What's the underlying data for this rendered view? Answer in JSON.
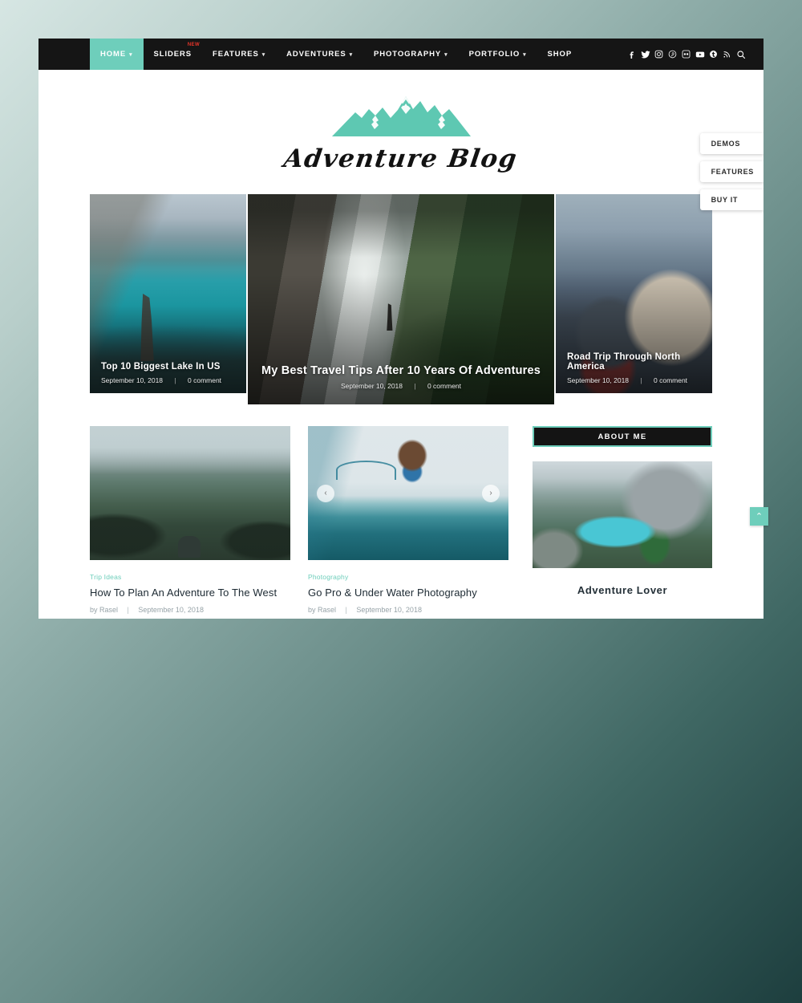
{
  "site": {
    "logo_text": "Adventure Blog",
    "logo_icon": "mountain-range-icon",
    "accent_color": "#6ecebb",
    "nav_bg_color": "#151515"
  },
  "nav": {
    "items": [
      {
        "label": "HOME",
        "has_caret": true,
        "active": true,
        "badge": null
      },
      {
        "label": "SLIDERS",
        "has_caret": false,
        "active": false,
        "badge": "NEW"
      },
      {
        "label": "FEATURES",
        "has_caret": true,
        "active": false,
        "badge": null
      },
      {
        "label": "ADVENTURES",
        "has_caret": true,
        "active": false,
        "badge": null
      },
      {
        "label": "PHOTOGRAPHY",
        "has_caret": true,
        "active": false,
        "badge": null
      },
      {
        "label": "PORTFOLIO",
        "has_caret": true,
        "active": false,
        "badge": null
      },
      {
        "label": "SHOP",
        "has_caret": false,
        "active": false,
        "badge": null
      }
    ],
    "socials": [
      "facebook-icon",
      "twitter-icon",
      "instagram-icon",
      "pinterest-icon",
      "flickr-icon",
      "youtube-icon",
      "tumblr-icon",
      "rss-icon",
      "search-icon"
    ]
  },
  "hero": {
    "slides": [
      {
        "title": "Top 10 Biggest Lake In US",
        "date": "September 10, 2018",
        "comments": "0 comment",
        "image": "turquoise-lake-with-hiker"
      },
      {
        "title": "My Best Travel Tips After 10 Years Of Adventures",
        "date": "September 10, 2018",
        "comments": "0 comment",
        "image": "waterfall-cliff-with-hiker"
      },
      {
        "title": "Road Trip Through North America",
        "date": "September 10, 2018",
        "comments": "0 comment",
        "image": "two-people-beanies-mountains"
      }
    ]
  },
  "posts": [
    {
      "category": "Trip Ideas",
      "title": "How To Plan An Adventure To The West",
      "author": "by Rasel",
      "date": "September 10, 2018",
      "image": "misty-forest-valley-photographer",
      "has_carousel": false
    },
    {
      "category": "Photography",
      "title": "Go Pro & Under Water Photography",
      "author": "by Rasel",
      "date": "September 10, 2018",
      "image": "diver-jumping-over-water",
      "has_carousel": true,
      "prev_label": "‹",
      "next_label": "›"
    }
  ],
  "sidebar": {
    "about": {
      "title": "ABOUT ME",
      "image": "couple-overlooking-turquoise-lake",
      "name": "Adventure Lover"
    }
  },
  "side_tabs": [
    {
      "label": "DEMOS"
    },
    {
      "label": "FEATURES"
    },
    {
      "label": "BUY IT"
    }
  ],
  "scroll_top": {
    "icon": "chevron-up-icon",
    "label": "⌃"
  }
}
